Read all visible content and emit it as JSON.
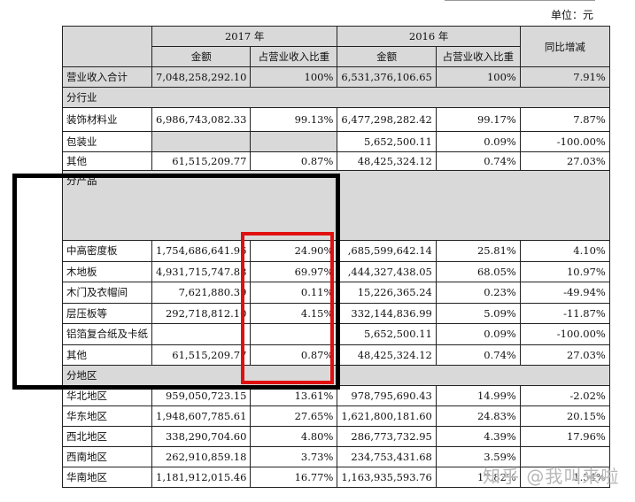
{
  "unit_label": "单位：元",
  "headers": {
    "year_2017": "2017 年",
    "year_2016": "2016 年",
    "yoy": "同比增减",
    "amount": "金额",
    "ratio": "占营业收入比重"
  },
  "total": {
    "label": "营业收入合计",
    "amt2017": "7,048,258,292.10",
    "pct2017": "100%",
    "amt2016": "6,531,376,106.65",
    "pct2016": "100%",
    "yoy": "7.91%"
  },
  "sections": {
    "industry": "分行业",
    "product": "分产品",
    "region": "分地区"
  },
  "industry_rows": [
    {
      "label": "装饰材料业",
      "amt2017": "6,986,743,082.33",
      "pct2017": "99.13%",
      "amt2016": "6,477,298,282.42",
      "pct2016": "99.17%",
      "yoy": "7.87%"
    },
    {
      "label": "包装业",
      "amt2017": "",
      "pct2017": "",
      "amt2016": "5,652,500.11",
      "pct2016": "0.09%",
      "yoy": "-100.00%"
    },
    {
      "label": "其他",
      "amt2017": "61,515,209.77",
      "pct2017": "0.87%",
      "amt2016": "48,425,324.12",
      "pct2016": "0.74%",
      "yoy": "27.03%"
    }
  ],
  "product_rows": [
    {
      "label": "中高密度板",
      "amt2017": "1,754,686,641.96",
      "pct2017": "24.90%",
      "amt2016": ",685,599,642.14",
      "pct2016": "25.81%",
      "yoy": "4.10%"
    },
    {
      "label": "木地板",
      "amt2017": "4,931,715,747.88",
      "pct2017": "69.97%",
      "amt2016": ",444,327,438.05",
      "pct2016": "68.05%",
      "yoy": "10.97%"
    },
    {
      "label": "木门及衣帽间",
      "amt2017": "7,621,880.39",
      "pct2017": "0.11%",
      "amt2016": "15,226,365.24",
      "pct2016": "0.23%",
      "yoy": "-49.94%"
    },
    {
      "label": "层压板等",
      "amt2017": "292,718,812.10",
      "pct2017": "4.15%",
      "amt2016": "332,144,836.99",
      "pct2016": "5.09%",
      "yoy": "-11.87%"
    },
    {
      "label": "铝箔复合纸及卡纸",
      "amt2017": "",
      "pct2017": "",
      "amt2016": "5,652,500.11",
      "pct2016": "0.09%",
      "yoy": "-100.00%"
    },
    {
      "label": "其他",
      "amt2017": "61,515,209.77",
      "pct2017": "0.87%",
      "amt2016": "48,425,324.12",
      "pct2016": "0.74%",
      "yoy": "27.03%"
    }
  ],
  "region_rows": [
    {
      "label": "华北地区",
      "amt2017": "959,050,723.15",
      "pct2017": "13.61%",
      "amt2016": "978,795,690.43",
      "pct2016": "14.99%",
      "yoy": "-2.02%"
    },
    {
      "label": "华东地区",
      "amt2017": "1,948,607,785.61",
      "pct2017": "27.65%",
      "amt2016": "1,621,800,181.60",
      "pct2016": "24.83%",
      "yoy": "20.15%"
    },
    {
      "label": "西北地区",
      "amt2017": "338,290,704.60",
      "pct2017": "4.80%",
      "amt2016": "286,773,732.95",
      "pct2016": "4.39%",
      "yoy": "17.96%"
    },
    {
      "label": "西南地区",
      "amt2017": "262,910,859.18",
      "pct2017": "3.73%",
      "amt2016": "234,753,431.68",
      "pct2016": "3.59%",
      "yoy": ""
    },
    {
      "label": "华南地区",
      "amt2017": "1,181,912,015.46",
      "pct2017": "16.77%",
      "amt2016": "1,163,935,593.76",
      "pct2016": "17.82%",
      "yoy": "1.54%"
    }
  ],
  "watermark": "知乎 @我叫来啦"
}
